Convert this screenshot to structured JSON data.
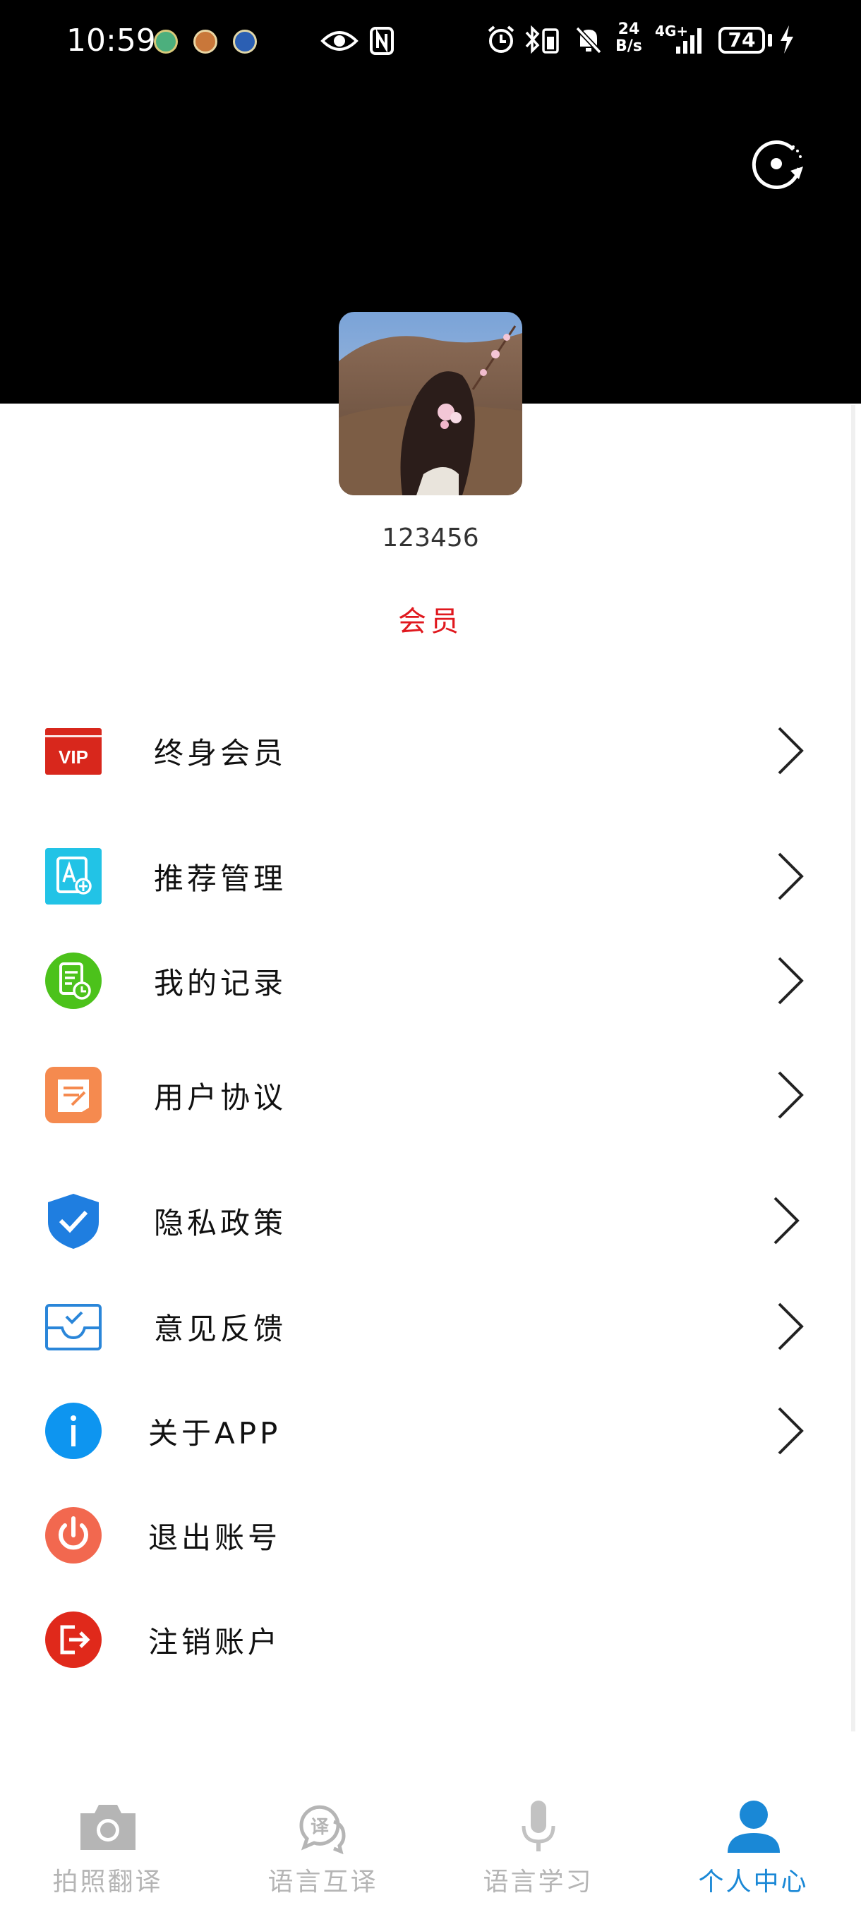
{
  "status_bar": {
    "time": "10:59",
    "speed_top": "24",
    "speed_bottom": "B/s",
    "network": "4G+",
    "battery": "74"
  },
  "profile": {
    "username": "123456",
    "member_label": "会员"
  },
  "menu": {
    "items": [
      {
        "label": "终身会员",
        "icon": "vip-icon",
        "has_chevron": true
      },
      {
        "label": "推荐管理",
        "icon": "translate-card-icon",
        "has_chevron": true
      },
      {
        "label": "我的记录",
        "icon": "record-icon",
        "has_chevron": true
      },
      {
        "label": "用户协议",
        "icon": "agreement-icon",
        "has_chevron": true
      },
      {
        "label": "隐私政策",
        "icon": "shield-check-icon",
        "has_chevron": true
      },
      {
        "label": "意见反馈",
        "icon": "feedback-tray-icon",
        "has_chevron": true
      },
      {
        "label": "关于APP",
        "icon": "info-icon",
        "has_chevron": true
      },
      {
        "label": "退出账号",
        "icon": "power-icon",
        "has_chevron": false
      },
      {
        "label": "注销账户",
        "icon": "exit-door-icon",
        "has_chevron": false
      }
    ]
  },
  "tabbar": {
    "tabs": [
      {
        "label": "拍照翻译",
        "icon": "camera-icon",
        "active": false
      },
      {
        "label": "语言互译",
        "icon": "translate-chat-icon",
        "active": false
      },
      {
        "label": "语言学习",
        "icon": "microphone-icon",
        "active": false
      },
      {
        "label": "个人中心",
        "icon": "person-icon",
        "active": true
      }
    ]
  },
  "colors": {
    "header_bg": "#000000",
    "member_red": "#e0181e",
    "active_tab": "#1a88d6",
    "inactive_tab": "#b5b5b5"
  }
}
